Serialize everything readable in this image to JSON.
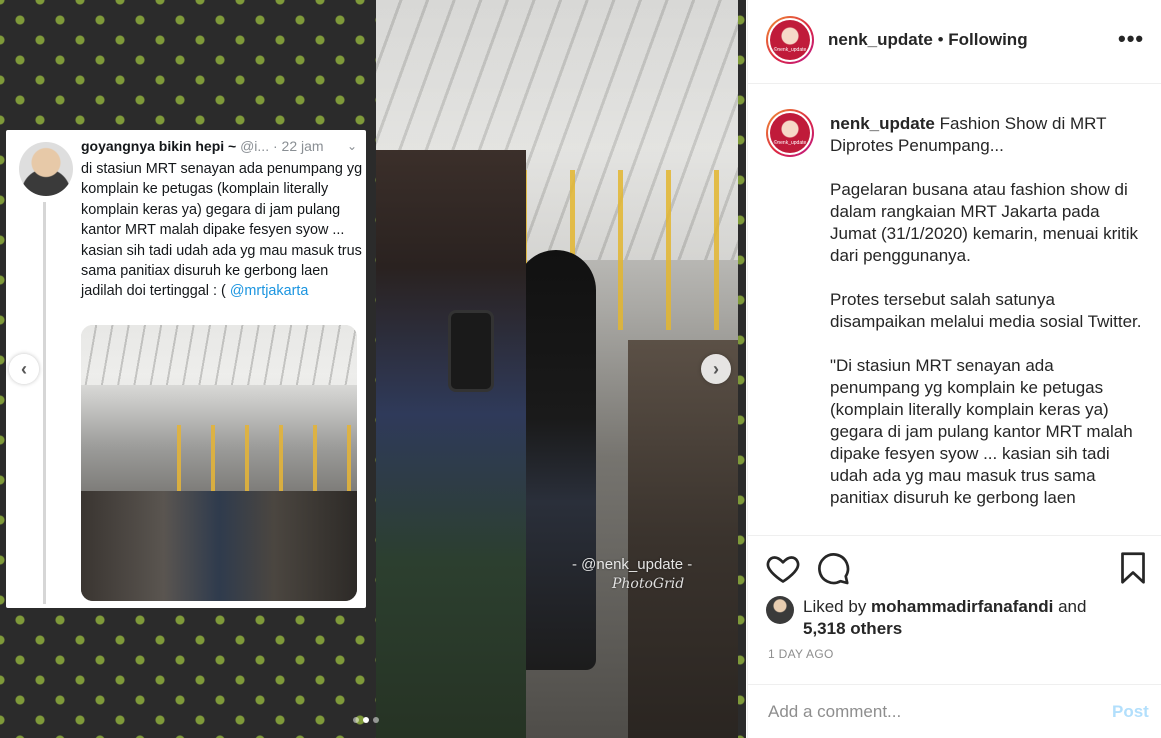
{
  "media": {
    "tweet": {
      "name": "goyangnya bikin hepi ~",
      "handle": "@i...",
      "date": "· 22 jam",
      "text": "di stasiun MRT senayan ada penumpang yg komplain ke petugas (komplain literally komplain keras ya) gegara di jam pulang kantor MRT malah dipake fesyen syow ... kasian sih tadi udah ada yg mau masuk trus sama panitiax disuruh ke gerbong laen jadilah doi tertinggal :",
      "text_tail": "( ",
      "mention": "@mrtjakarta"
    },
    "watermark": "- @nenk_update -",
    "watermark_sub": "PhotoGrid",
    "nav_prev_icon": "chevron-left-icon",
    "nav_next_icon": "chevron-right-icon",
    "carousel": {
      "total": 3,
      "active_index": 1
    }
  },
  "header": {
    "username": "nenk_update",
    "separator": " • ",
    "follow_status": "Following",
    "more_icon": "•••",
    "avatar_text": "©nenk_update"
  },
  "caption": {
    "username": "nenk_update",
    "paragraphs": [
      "Fashion Show di MRT Diprotes Penumpang...",
      "Pagelaran busana atau fashion show di dalam rangkaian MRT Jakarta pada Jumat (31/1/2020) kemarin, menuai kritik dari penggunanya.",
      "Protes tersebut salah satunya disampaikan melalui media sosial Twitter.",
      "\"Di stasiun MRT senayan ada penumpang yg komplain ke petugas (komplain literally komplain keras ya) gegara di jam pulang kantor MRT malah dipake fesyen syow ... kasian sih tadi udah ada yg mau masuk trus sama panitiax disuruh ke gerbong laen"
    ]
  },
  "actions": {
    "icons": [
      "heart-icon",
      "comment-icon",
      "bookmark-icon"
    ],
    "liked_by_prefix": "Liked by ",
    "liked_by_user": "mohammadirfanafandi",
    "liked_by_and": " and",
    "others": "5,318 others",
    "time": "1 DAY AGO"
  },
  "comment": {
    "placeholder": "Add a comment...",
    "post_label": "Post",
    "post_color": "#b2dffc"
  },
  "colors": {
    "background_pattern": "#2b2b2b",
    "pattern_accent": "#7f9a3a",
    "mention_blue": "#1b95e0",
    "secondary_text": "#8e8e8e"
  }
}
